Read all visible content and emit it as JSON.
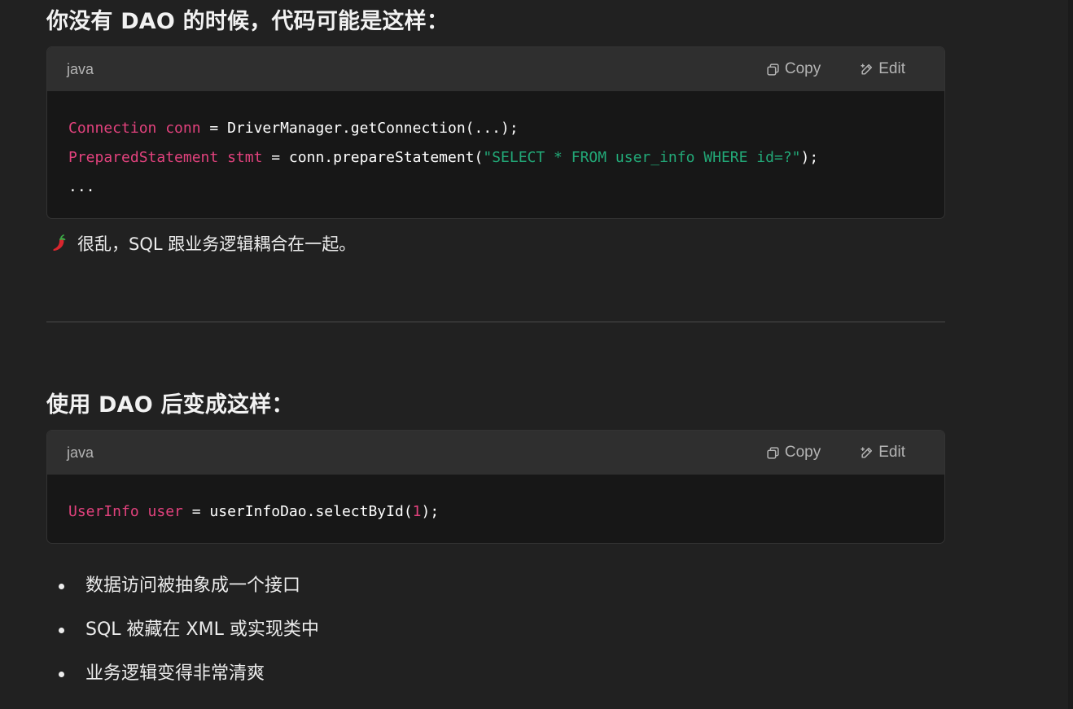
{
  "heading_before": "你没有 DAO 的时候，代码可能是这样：",
  "code_block_1": {
    "language": "java",
    "copy_label": "Copy",
    "edit_label": "Edit",
    "lines": [
      [
        {
          "t": "Connection conn",
          "c": "kw"
        },
        {
          "t": " = DriverManager.getConnection(...);",
          "c": "plain"
        }
      ],
      [
        {
          "t": "PreparedStatement stmt",
          "c": "kw"
        },
        {
          "t": " = conn.prepareStatement(",
          "c": "plain"
        },
        {
          "t": "\"SELECT * FROM user_info WHERE id=?\"",
          "c": "str"
        },
        {
          "t": ");",
          "c": "plain"
        }
      ],
      [
        {
          "t": "...",
          "c": "plain"
        }
      ]
    ]
  },
  "note": {
    "icon": "chili-pepper-icon",
    "text": "很乱，SQL 跟业务逻辑耦合在一起。"
  },
  "heading_after": "使用 DAO 后变成这样：",
  "code_block_2": {
    "language": "java",
    "copy_label": "Copy",
    "edit_label": "Edit",
    "lines": [
      [
        {
          "t": "UserInfo user",
          "c": "kw"
        },
        {
          "t": " = userInfoDao.selectById(",
          "c": "plain"
        },
        {
          "t": "1",
          "c": "num"
        },
        {
          "t": ");",
          "c": "plain"
        }
      ]
    ]
  },
  "bullets": [
    "数据访问被抽象成一个接口",
    "SQL 被藏在 XML 或实现类中",
    "业务逻辑变得非常清爽"
  ],
  "colors": {
    "background": "#212121",
    "code_header": "#2f2f2f",
    "code_body": "#171717",
    "keyword": "#e2427d",
    "string": "#22a877"
  }
}
